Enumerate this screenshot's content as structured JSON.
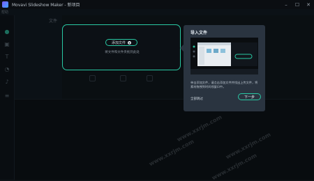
{
  "window": {
    "title": "Movavi Slideshow Maker - 新项目",
    "controls": [
      "minimize-icon",
      "maximize-icon",
      "close-icon"
    ]
  },
  "menubar": {
    "label": "帮助"
  },
  "file_panel": {
    "heading": "文件"
  },
  "drop_zone": {
    "add_button_label": "添加文件",
    "hint": "将文件和文件夹拖到此处"
  },
  "tour": {
    "title": "导入文件",
    "description": "单击添加文件，请点击添加文件并找出上传文件，将素材拖拽到时间线窗口中。",
    "skip_label": "全部跳过",
    "next_label": "下一步"
  },
  "accent_color": "#29c9a4",
  "watermark_text": "www.xxrjm.com"
}
